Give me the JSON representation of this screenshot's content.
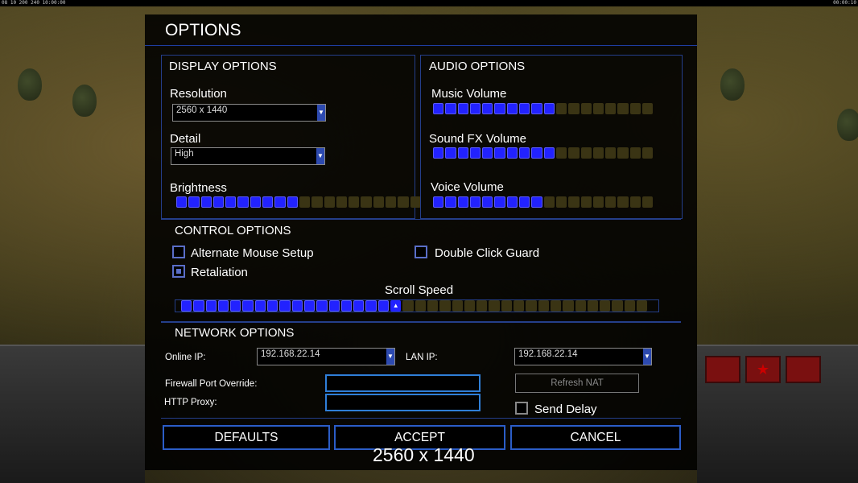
{
  "hud": {
    "top_left": "08 10 200 240 10:00:00",
    "top_right": "00:00:10"
  },
  "title": "OPTIONS",
  "display": {
    "heading": "DISPLAY OPTIONS",
    "resolution_label": "Resolution",
    "resolution_value": "2560 x 1440",
    "detail_label": "Detail",
    "detail_value": "High",
    "brightness_label": "Brightness",
    "brightness_level": 10,
    "brightness_total": 20
  },
  "audio": {
    "heading": "AUDIO OPTIONS",
    "music_label": "Music Volume",
    "music_level": 10,
    "sfx_label": "Sound FX Volume",
    "sfx_level": 10,
    "voice_label": "Voice Volume",
    "voice_level": 9,
    "total": 18
  },
  "control": {
    "heading": "CONTROL OPTIONS",
    "alt_mouse_label": "Alternate Mouse Setup",
    "alt_mouse_checked": false,
    "double_click_label": "Double Click Guard",
    "double_click_checked": false,
    "retaliation_label": "Retaliation",
    "retaliation_checked": true,
    "scroll_label": "Scroll Speed",
    "scroll_level": 18,
    "scroll_total": 38
  },
  "network": {
    "heading": "NETWORK OPTIONS",
    "online_ip_label": "Online IP:",
    "online_ip_value": "192.168.22.14",
    "lan_ip_label": "LAN IP:",
    "lan_ip_value": "192.168.22.14",
    "firewall_label": "Firewall Port Override:",
    "firewall_value": "",
    "proxy_label": "HTTP Proxy:",
    "proxy_value": "",
    "refresh_nat_label": "Refresh NAT",
    "send_delay_label": "Send Delay",
    "send_delay_checked": false
  },
  "buttons": {
    "defaults": "DEFAULTS",
    "accept": "ACCEPT",
    "cancel": "CANCEL"
  },
  "overlay_text": "2560 x 1440",
  "colors": {
    "accent": "#2b5dc7",
    "slider_on": "#2222ff",
    "slider_off": "#3a3414"
  }
}
